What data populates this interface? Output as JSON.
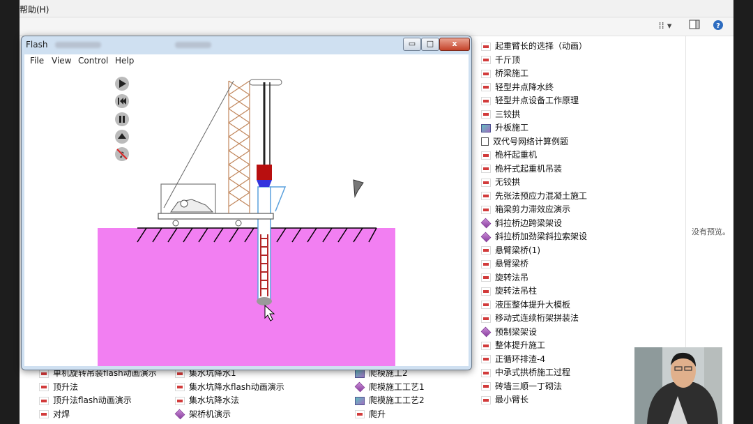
{
  "explorer": {
    "menu": {
      "help": "帮助(H)"
    },
    "preview": {
      "no_preview": "没有预览。"
    }
  },
  "flash_window": {
    "title": "Flash",
    "menu": [
      "File",
      "View",
      "Control",
      "Help"
    ],
    "controls": {
      "minimize": "▭",
      "maximize": "□",
      "close": "x"
    }
  },
  "file_list_right": [
    {
      "name": "起重臂长的选择（动画）",
      "icon": "swf"
    },
    {
      "name": "千斤顶",
      "icon": "swf"
    },
    {
      "name": "桥梁施工",
      "icon": "swf"
    },
    {
      "name": "轻型井点降水终",
      "icon": "swf"
    },
    {
      "name": "轻型井点设备工作原理",
      "icon": "swf"
    },
    {
      "name": "三铰拱",
      "icon": "swf"
    },
    {
      "name": "升板施工",
      "icon": "app"
    },
    {
      "name": "双代号网络计算例题",
      "icon": "doc"
    },
    {
      "name": "桅杆起重机",
      "icon": "swf"
    },
    {
      "name": "桅杆式起重机吊装",
      "icon": "swf"
    },
    {
      "name": "无铰拱",
      "icon": "swf"
    },
    {
      "name": "先张法预应力混凝土施工",
      "icon": "swf"
    },
    {
      "name": "箱梁剪力滞效应演示",
      "icon": "swf"
    },
    {
      "name": "斜拉桥边跨梁架设",
      "icon": "flash"
    },
    {
      "name": "斜拉桥加劲梁斜拉索架设",
      "icon": "flash"
    },
    {
      "name": "悬臂梁桥(1)",
      "icon": "swf"
    },
    {
      "name": "悬臂梁桥",
      "icon": "swf"
    },
    {
      "name": "旋转法吊",
      "icon": "swf"
    },
    {
      "name": "旋转法吊柱",
      "icon": "swf"
    },
    {
      "name": "液压整体提升大模板",
      "icon": "swf"
    },
    {
      "name": "移动式连续桁架拼装法",
      "icon": "swf"
    },
    {
      "name": "预制梁架设",
      "icon": "flash"
    },
    {
      "name": "整体提升施工",
      "icon": "swf"
    },
    {
      "name": "正循环排渣-4",
      "icon": "swf"
    },
    {
      "name": "中承式拱桥施工过程",
      "icon": "swf"
    },
    {
      "name": "砖墙三顺一丁砌法",
      "icon": "swf"
    },
    {
      "name": "最小臂长",
      "icon": "swf"
    }
  ],
  "file_list_bottom": {
    "col1": [
      {
        "name": "单机旋转吊装flash动画演示",
        "icon": "swf"
      },
      {
        "name": "顶升法",
        "icon": "swf"
      },
      {
        "name": "顶升法flash动画演示",
        "icon": "swf"
      },
      {
        "name": "对焊",
        "icon": "swf"
      }
    ],
    "col2": [
      {
        "name": "集水坑降水1",
        "icon": "swf"
      },
      {
        "name": "集水坑降水flash动画演示",
        "icon": "swf"
      },
      {
        "name": "集水坑降水法",
        "icon": "swf"
      },
      {
        "name": "架桥机演示",
        "icon": "flash"
      }
    ],
    "col3": [
      {
        "name": "爬模施工2",
        "icon": "app"
      },
      {
        "name": "爬模施工工艺1",
        "icon": "flash"
      },
      {
        "name": "爬模施工工艺2",
        "icon": "app"
      },
      {
        "name": "爬升",
        "icon": "swf"
      }
    ]
  },
  "colors": {
    "ground": "#f27ff2",
    "crane_lattice": "#c1875c",
    "hammer": "#b80f0f",
    "cage": "#b32626",
    "casing": "#5aa0dd"
  }
}
